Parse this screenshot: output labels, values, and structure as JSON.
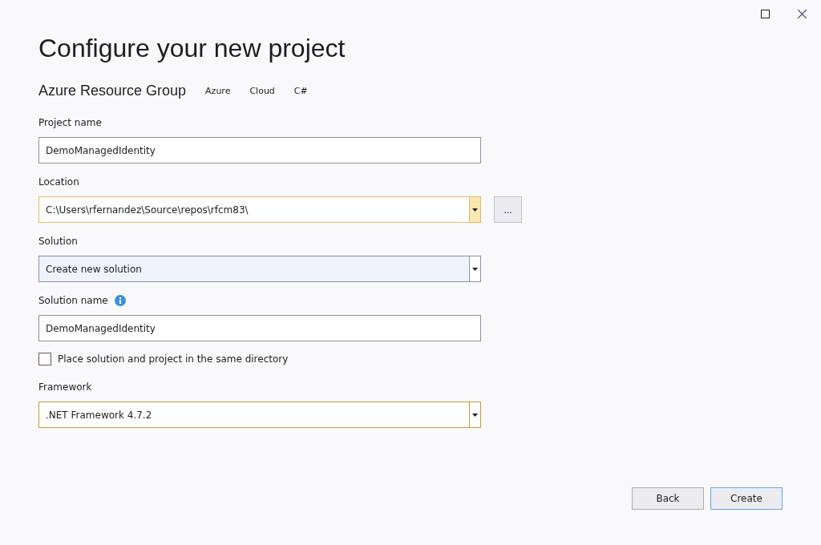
{
  "window": {
    "title": "Configure your new project"
  },
  "template": {
    "name": "Azure Resource Group",
    "tags": [
      "Azure",
      "Cloud",
      "C#"
    ]
  },
  "fields": [
    {
      "kind": "text",
      "label": "Project name",
      "value": "DemoManagedIdentity"
    },
    {
      "kind": "combo",
      "label": "Location",
      "value": "C:\\Users\\rfernandez\\Source\\repos\\rfcm83\\",
      "hovered": true,
      "focused": false,
      "browse": "..."
    },
    {
      "kind": "combo",
      "label": "Solution",
      "value": "Create new solution",
      "hovered": false,
      "focused": false
    },
    {
      "kind": "text",
      "label": "Solution name",
      "value": "DemoManagedIdentity",
      "info": true
    },
    {
      "kind": "checkbox",
      "label": "Place solution and project in the same directory",
      "checked": false
    },
    {
      "kind": "combo",
      "label": "Framework",
      "value": ".NET Framework 4.7.2",
      "hovered": false,
      "focused": true
    }
  ],
  "buttons": [
    {
      "label": "Back",
      "default": false
    },
    {
      "label": "Create",
      "default": true
    }
  ]
}
